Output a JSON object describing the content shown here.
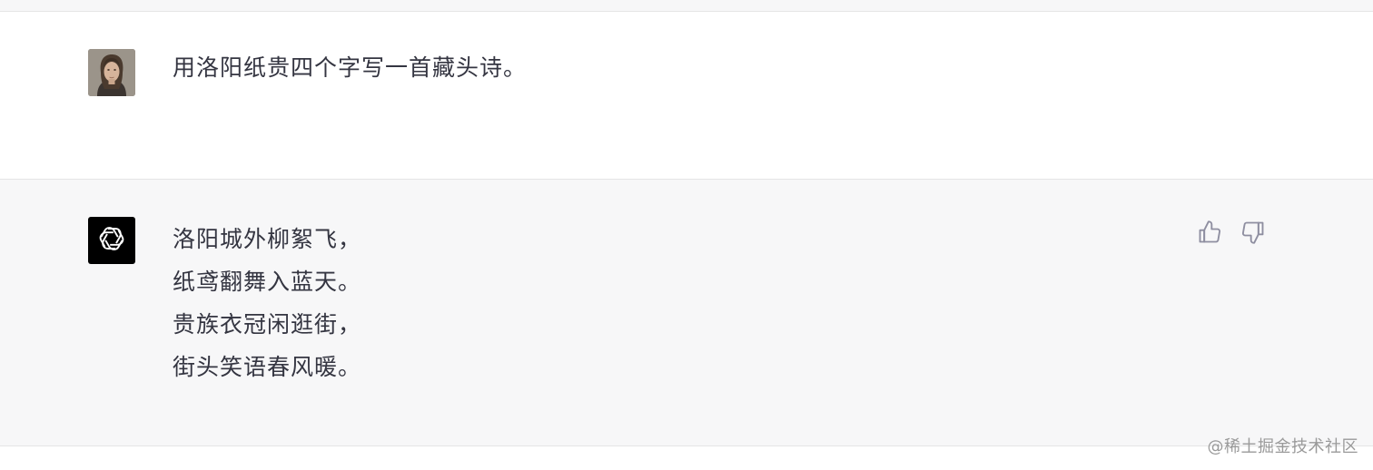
{
  "conversation": {
    "user_message": {
      "avatar": "user-portrait-avatar",
      "text": "用洛阳纸贵四个字写一首藏头诗。"
    },
    "assistant_message": {
      "avatar": "openai-logo-icon",
      "lines": [
        "洛阳城外柳絮飞，",
        "纸鸢翻舞入蓝天。",
        "贵族衣冠闲逛街，",
        "街头笑语春风暖。"
      ],
      "actions": {
        "thumbs_up_icon": "thumbs-up-icon",
        "thumbs_down_icon": "thumbs-down-icon"
      }
    }
  },
  "watermark": "@稀土掘金技术社区",
  "colors": {
    "user_bg": "#ffffff",
    "assistant_bg": "#f7f7f8",
    "text": "#343541",
    "icon": "#8e8ea0"
  }
}
